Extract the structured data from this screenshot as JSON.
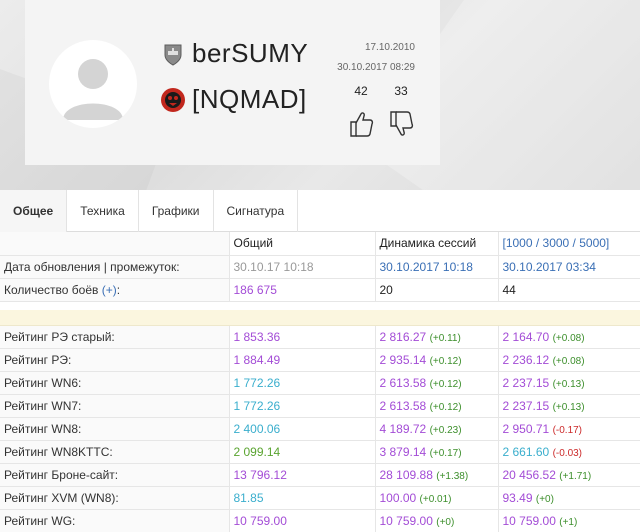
{
  "profile": {
    "player_name": "berSUMY",
    "clan_tag": "[NQMAD]",
    "registered_date": "17.10.2010",
    "last_battle_datetime": "30.10.2017 08:29",
    "likes": "42",
    "dislikes": "33"
  },
  "tabs": [
    {
      "label": "Общее",
      "active": true
    },
    {
      "label": "Техника",
      "active": false
    },
    {
      "label": "Графики",
      "active": false
    },
    {
      "label": "Сигнатура",
      "active": false
    }
  ],
  "table": {
    "headers": {
      "total": "Общий",
      "dynamics": "Динамика сессий",
      "ranges": "[1000 / 3000 / 5000]"
    },
    "update_row": {
      "label": "Дата обновления | промежуток:",
      "total": "30.10.17 10:18",
      "dynamics": "30.10.2017 10:18",
      "ranges": "30.10.2017 03:34"
    },
    "battles_row": {
      "label": "Количество боёв",
      "label_link": "(+)",
      "label_suffix": ":",
      "total": "186 675",
      "dynamics": "20",
      "ranges": "44"
    },
    "ratings": [
      {
        "label": "Рейтинг РЭ старый:",
        "total": "1 853.36",
        "total_color": "pur",
        "dyn": "2 816.27",
        "dyn_color": "pur",
        "dyn_delta": "(+0.11)",
        "dyn_delta_sign": "pos",
        "rng": "2 164.70",
        "rng_color": "pur",
        "rng_delta": "(+0.08)",
        "rng_delta_sign": "pos"
      },
      {
        "label": "Рейтинг РЭ:",
        "total": "1 884.49",
        "total_color": "pur",
        "dyn": "2 935.14",
        "dyn_color": "pur",
        "dyn_delta": "(+0.12)",
        "dyn_delta_sign": "pos",
        "rng": "2 236.12",
        "rng_color": "pur",
        "rng_delta": "(+0.08)",
        "rng_delta_sign": "pos"
      },
      {
        "label": "Рейтинг WN6:",
        "total": "1 772.26",
        "total_color": "cyan",
        "dyn": "2 613.58",
        "dyn_color": "pur",
        "dyn_delta": "(+0.12)",
        "dyn_delta_sign": "pos",
        "rng": "2 237.15",
        "rng_color": "pur",
        "rng_delta": "(+0.13)",
        "rng_delta_sign": "pos"
      },
      {
        "label": "Рейтинг WN7:",
        "total": "1 772.26",
        "total_color": "cyan",
        "dyn": "2 613.58",
        "dyn_color": "pur",
        "dyn_delta": "(+0.12)",
        "dyn_delta_sign": "pos",
        "rng": "2 237.15",
        "rng_color": "pur",
        "rng_delta": "(+0.13)",
        "rng_delta_sign": "pos"
      },
      {
        "label": "Рейтинг WN8:",
        "total": "2 400.06",
        "total_color": "cyan",
        "dyn": "4 189.72",
        "dyn_color": "pur",
        "dyn_delta": "(+0.23)",
        "dyn_delta_sign": "pos",
        "rng": "2 950.71",
        "rng_color": "pur",
        "rng_delta": "(-0.17)",
        "rng_delta_sign": "neg"
      },
      {
        "label": "Рейтинг WN8KTTC:",
        "total": "2 099.14",
        "total_color": "grn",
        "dyn": "3 879.14",
        "dyn_color": "pur",
        "dyn_delta": "(+0.17)",
        "dyn_delta_sign": "pos",
        "rng": "2 661.60",
        "rng_color": "cyan",
        "rng_delta": "(-0.03)",
        "rng_delta_sign": "neg"
      },
      {
        "label": "Рейтинг Броне-сайт:",
        "total": "13 796.12",
        "total_color": "pur",
        "dyn": "28 109.88",
        "dyn_color": "pur",
        "dyn_delta": "(+1.38)",
        "dyn_delta_sign": "pos",
        "rng": "20 456.52",
        "rng_color": "pur",
        "rng_delta": "(+1.71)",
        "rng_delta_sign": "pos"
      },
      {
        "label": "Рейтинг XVM (WN8):",
        "total": "81.85",
        "total_color": "cyan",
        "dyn": "100.00",
        "dyn_color": "pur",
        "dyn_delta": "(+0.01)",
        "dyn_delta_sign": "pos",
        "rng": "93.49",
        "rng_color": "pur",
        "rng_delta": "(+0)",
        "rng_delta_sign": "pos"
      },
      {
        "label": "Рейтинг WG:",
        "total": "10 759.00",
        "total_color": "pur",
        "dyn": "10 759.00",
        "dyn_color": "pur",
        "dyn_delta": "(+0)",
        "dyn_delta_sign": "pos",
        "rng": "10 759.00",
        "rng_color": "pur",
        "rng_delta": "(+1)",
        "rng_delta_sign": "pos"
      }
    ]
  },
  "colors": {
    "purple": "#a34cd6",
    "cyan": "#3aaecd",
    "green": "#5aa430",
    "link_blue": "#3a6fb5",
    "delta_positive": "#3d8f2c",
    "delta_negative": "#cc2a2a"
  }
}
